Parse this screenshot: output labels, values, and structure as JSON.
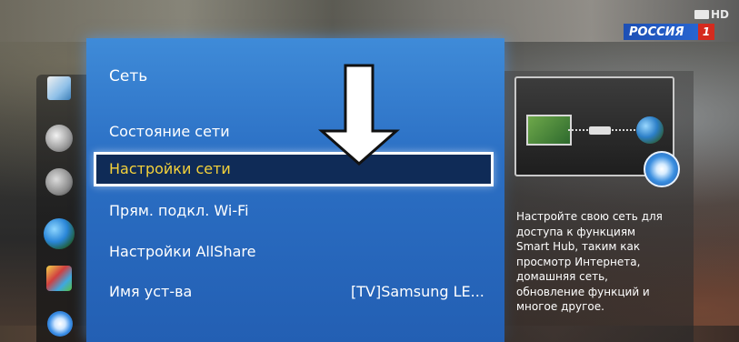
{
  "status_bar": {
    "hd_label": "HD",
    "channel_name": "РОССИЯ",
    "channel_number": "1"
  },
  "menu": {
    "title": "Сеть",
    "items": [
      {
        "label": "Состояние сети",
        "selected": false
      },
      {
        "label": "Настройки сети",
        "selected": true
      },
      {
        "label": "Прям. подкл. Wi-Fi",
        "selected": false
      },
      {
        "label": "Настройки AllShare",
        "selected": false
      },
      {
        "label": "Имя уст-ва",
        "value": "[TV]Samsung LE...",
        "selected": false
      }
    ]
  },
  "help": {
    "lines": [
      "Настройте свою сеть для",
      "доступа к функциям",
      "Smart Hub, таким как",
      "просмотр Интернета,",
      "домашняя сеть,",
      "обновление функций и",
      "многое другое."
    ]
  },
  "side_icons": [
    "photo-icon",
    "speaker-icon",
    "disc-icon",
    "globe-icon",
    "cube-icon",
    "gear-icon"
  ],
  "colors": {
    "panel_blue": "#2b6fc4",
    "selected_text": "#f5d23a",
    "highlight_bg": "#0f2b57"
  }
}
